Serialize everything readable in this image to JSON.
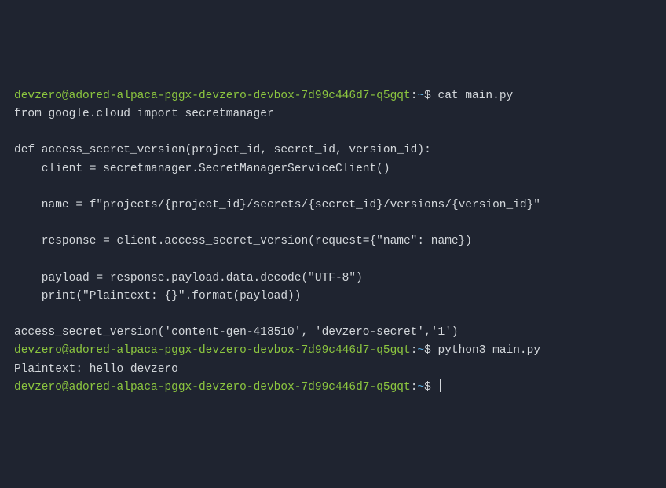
{
  "prompt": {
    "user": "devzero",
    "at": "@",
    "host": "adored-alpaca-pggx-devzero-devbox-7d99c446d7-q5gqt",
    "colon": ":",
    "path": "~",
    "dollar": "$ "
  },
  "commands": {
    "cat": "cat main.py",
    "python": "python3 main.py",
    "empty": ""
  },
  "file_lines": {
    "l1": "from google.cloud import secretmanager",
    "l2": "",
    "l3": "def access_secret_version(project_id, secret_id, version_id):",
    "l4": "    client = secretmanager.SecretManagerServiceClient()",
    "l5": "",
    "l6": "    name = f\"projects/{project_id}/secrets/{secret_id}/versions/{version_id}\"",
    "l7": "",
    "l8": "    response = client.access_secret_version(request={\"name\": name})",
    "l9": "",
    "l10": "    payload = response.payload.data.decode(\"UTF-8\")",
    "l11": "    print(\"Plaintext: {}\".format(payload))",
    "l12": "",
    "l13": "access_secret_version('content-gen-418510', 'devzero-secret','1')"
  },
  "run_output": "Plaintext: hello devzero"
}
